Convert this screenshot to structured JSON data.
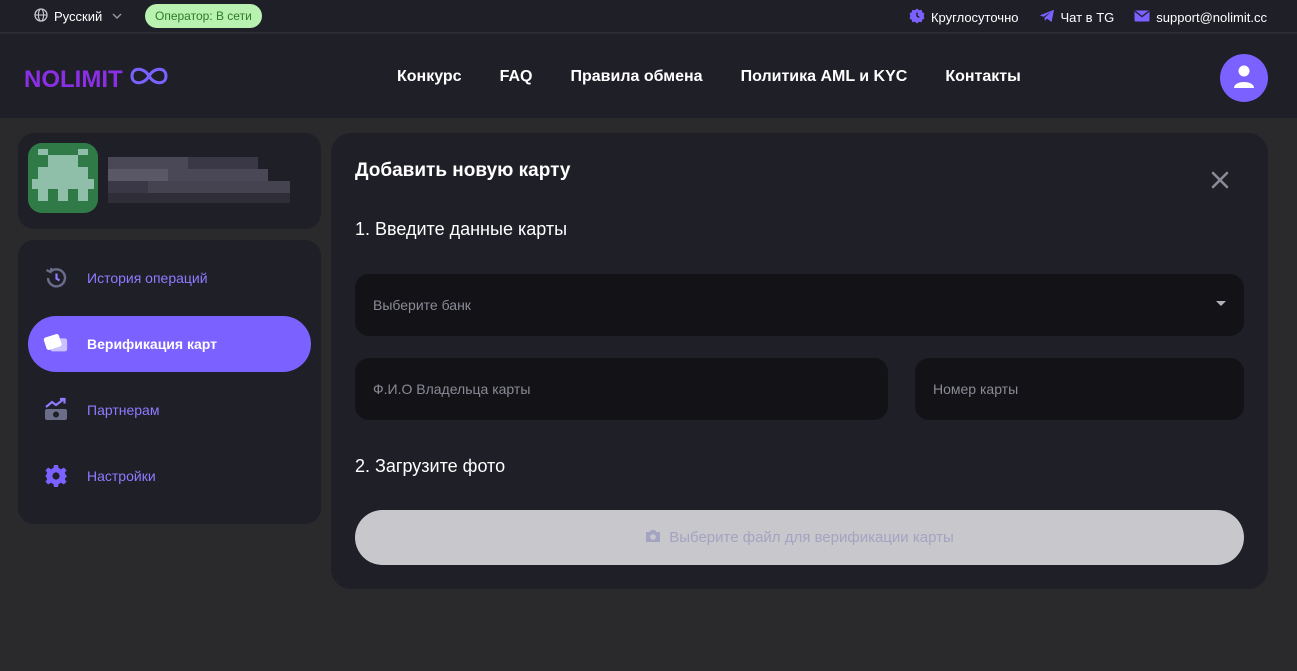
{
  "topbar": {
    "language": "Русский",
    "operator_status": "Оператор: В сети",
    "hours": "Круглосуточно",
    "chat": "Чат в TG",
    "email": "support@nolimit.cc"
  },
  "header": {
    "logo_text": "NOLIMIT",
    "nav": [
      "Конкурс",
      "FAQ",
      "Правила обмена",
      "Политика AML и KYC",
      "Контакты"
    ]
  },
  "sidebar": {
    "items": [
      {
        "label": "История операций",
        "icon": "history-icon",
        "active": false
      },
      {
        "label": "Верификация карт",
        "icon": "cards-icon",
        "active": true
      },
      {
        "label": "Партнерам",
        "icon": "partners-icon",
        "active": false
      },
      {
        "label": "Настройки",
        "icon": "gear-icon",
        "active": false
      }
    ]
  },
  "form": {
    "title": "Добавить новую карту",
    "step1": "1. Введите данные карты",
    "bank_placeholder": "Выберите банк",
    "holder_placeholder": "Ф.И.О Владельца карты",
    "number_placeholder": "Номер карты",
    "step2": "2. Загрузите фото",
    "upload_label": "Выберите файл для верификации карты"
  },
  "colors": {
    "accent": "#7b61ff",
    "card_bg": "#1f1f28",
    "page_bg": "#2a2a2c",
    "field_bg": "#121217",
    "online_badge": "#b9f2b0"
  }
}
